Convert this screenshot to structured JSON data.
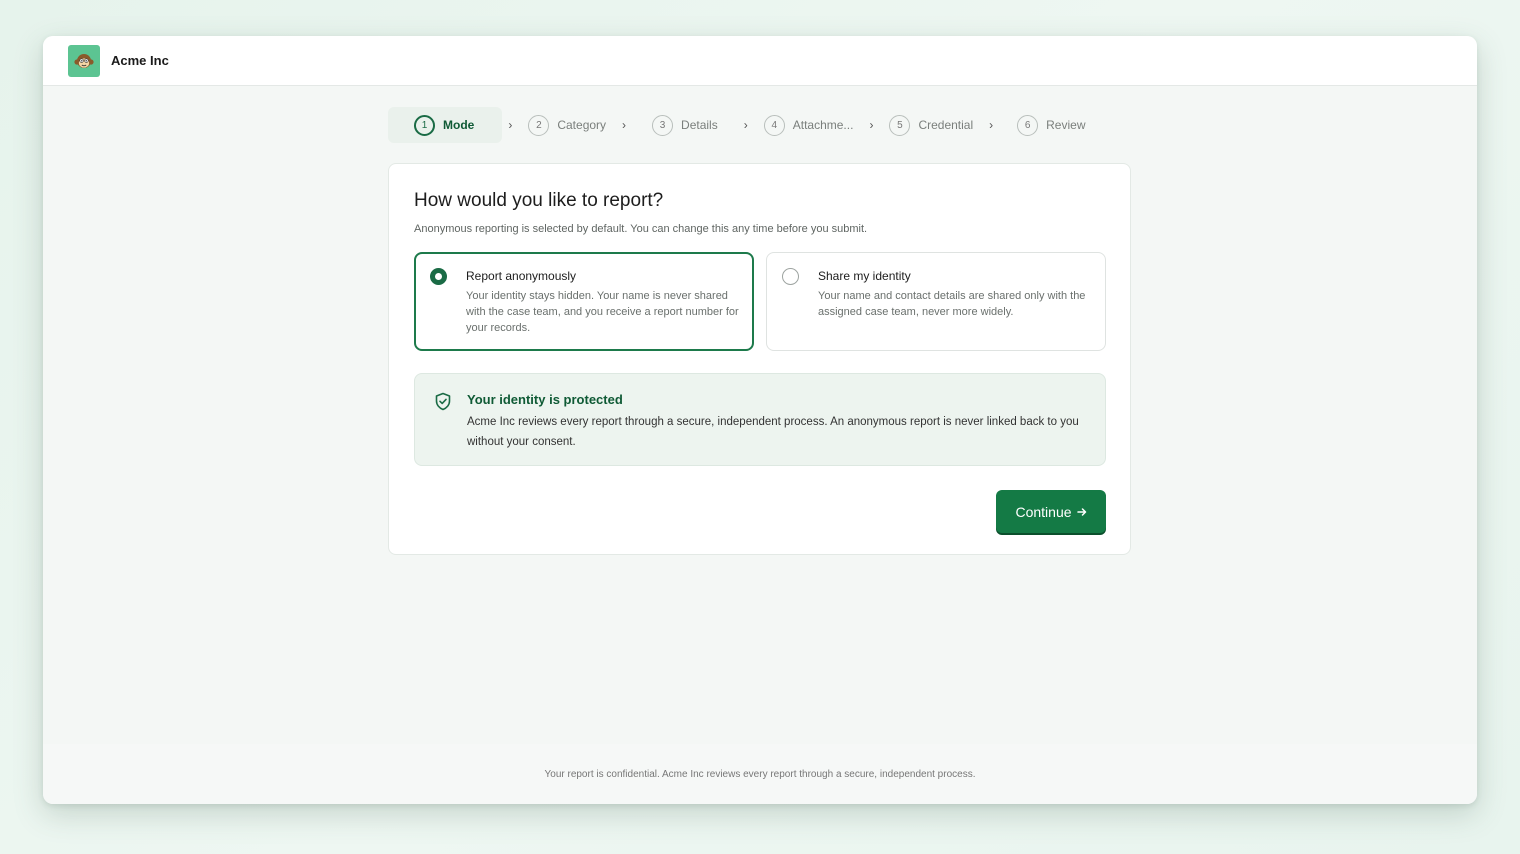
{
  "app": {
    "brand": "Acme Inc",
    "logo_icon": "monkey-icon",
    "accent_color": "#147a45"
  },
  "steps": [
    {
      "num": "1",
      "label": "Mode",
      "active": true
    },
    {
      "num": "2",
      "label": "Category",
      "active": false
    },
    {
      "num": "3",
      "label": "Details",
      "active": false
    },
    {
      "num": "4",
      "label": "Attachme...",
      "active": false
    },
    {
      "num": "5",
      "label": "Credential",
      "active": false
    },
    {
      "num": "6",
      "label": "Review",
      "active": false
    }
  ],
  "step_separator": "›",
  "card": {
    "title": "How would you like to report?",
    "subtitle": "Anonymous reporting is selected by default. You can change this any time before you submit."
  },
  "options": [
    {
      "title": "Report anonymously",
      "description": "Your identity stays hidden. Your name is never shared with the case team, and you receive a report number for your records.",
      "selected": true
    },
    {
      "title": "Share my identity",
      "description": "Your name and contact details are shared only with the assigned case team, never more widely.",
      "selected": false
    }
  ],
  "notice": {
    "icon": "shield-check-icon",
    "title": "Your identity is protected",
    "body": "Acme Inc reviews every report through a secure, independent process. An anonymous report is never linked back to you without your consent."
  },
  "actions": {
    "continue_label": "Continue",
    "continue_icon": "arrow-right-icon"
  },
  "footer": {
    "text": "Your report is confidential. Acme Inc reviews every report through a secure, independent process."
  }
}
